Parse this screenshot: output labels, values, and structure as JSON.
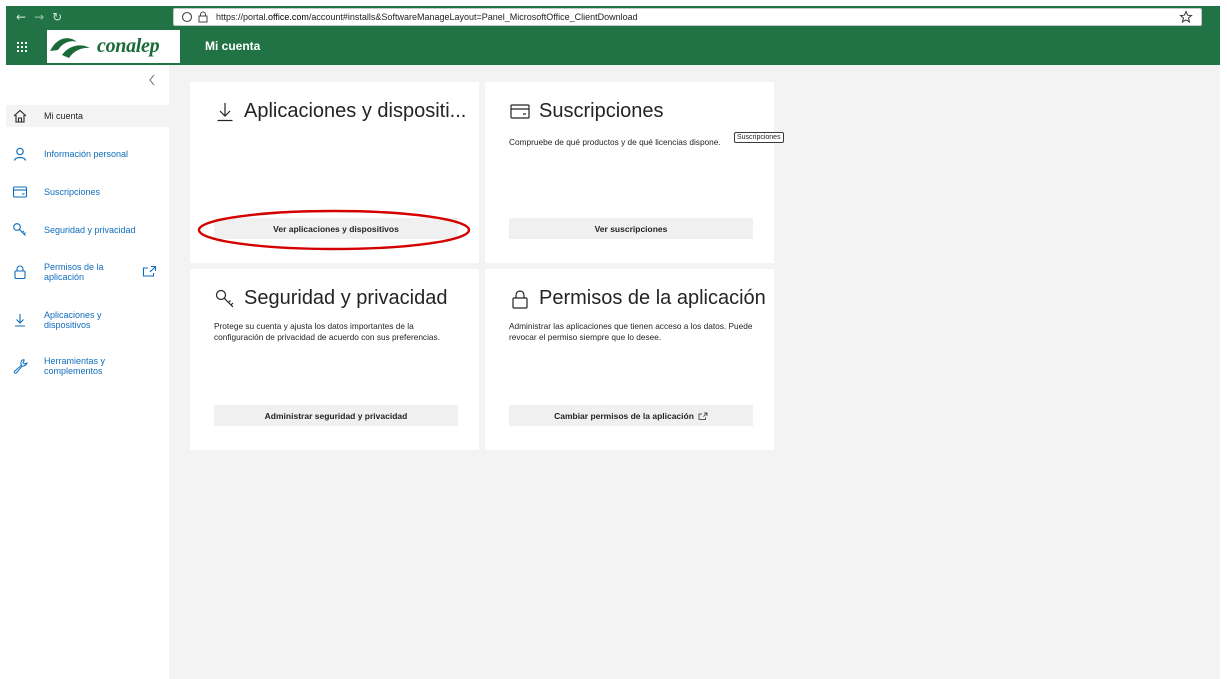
{
  "browser": {
    "url_prefix": "https://portal.",
    "url_domain": "office.com",
    "url_path": "/account#installs&SoftwareManageLayout=Panel_MicrosoftOffice_ClientDownload"
  },
  "header": {
    "brand": "conalep",
    "title": "Mi cuenta",
    "accent_color": "#217346"
  },
  "sidebar": {
    "items": [
      {
        "label": "Mi cuenta",
        "icon": "home-icon"
      },
      {
        "label": "Información personal",
        "icon": "person-icon"
      },
      {
        "label": "Suscripciones",
        "icon": "card-icon"
      },
      {
        "label": "Seguridad y privacidad",
        "icon": "key-icon"
      },
      {
        "label": "Permisos de la aplicación",
        "icon": "lock-icon"
      },
      {
        "label": "Aplicaciones y dispositivos",
        "icon": "download-icon"
      },
      {
        "label": "Herramientas y complementos",
        "icon": "wrench-icon"
      }
    ]
  },
  "cards": {
    "apps": {
      "title": "Aplicaciones y dispositi...",
      "button": "Ver aplicaciones y dispositivos",
      "icon": "download-icon"
    },
    "subs": {
      "title": "Suscripciones",
      "desc": "Compruebe de qué productos y de qué licencias dispone.",
      "button": "Ver suscripciones",
      "tooltip": "Suscripciones",
      "icon": "card-icon"
    },
    "security": {
      "title": "Seguridad y privacidad",
      "desc": "Protege su cuenta y ajusta los datos importantes de la configuración de privacidad de acuerdo con sus preferencias.",
      "button": "Administrar seguridad y privacidad",
      "icon": "key-icon"
    },
    "perms": {
      "title": "Permisos de la aplicación",
      "desc": "Administrar las aplicaciones que tienen acceso a los datos. Puede revocar el permiso siempre que lo desee.",
      "button": "Cambiar permisos de la aplicación",
      "icon": "lock-icon"
    }
  },
  "annotation": {
    "highlight_color": "#d40000"
  }
}
